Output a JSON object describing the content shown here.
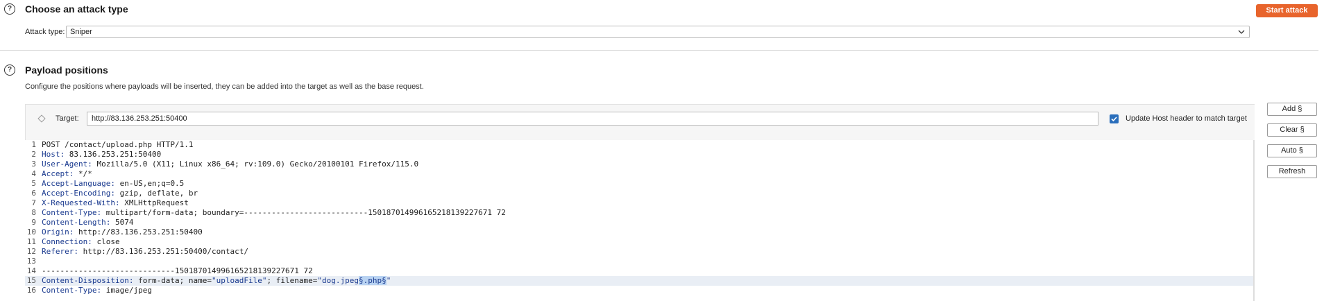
{
  "attack_section": {
    "title": "Choose an attack type",
    "start_button": "Start attack",
    "attack_type_label": "Attack type:",
    "attack_type_value": "Sniper"
  },
  "positions_section": {
    "title": "Payload positions",
    "description": "Configure the positions where payloads will be inserted, they can be added into the target as well as the base request.",
    "target_label": "Target:",
    "target_value": "http://83.136.253.251:50400",
    "update_host_label": "Update Host header to match target",
    "update_host_checked": true,
    "buttons": {
      "add": "Add §",
      "clear": "Clear §",
      "auto": "Auto §",
      "refresh": "Refresh"
    }
  },
  "request_lines": [
    {
      "n": "1",
      "name": "",
      "value": "POST /contact/upload.php HTTP/1.1"
    },
    {
      "n": "2",
      "name": "Host:",
      "value": " 83.136.253.251:50400"
    },
    {
      "n": "3",
      "name": "User-Agent:",
      "value": " Mozilla/5.0 (X11; Linux x86_64; rv:109.0) Gecko/20100101 Firefox/115.0"
    },
    {
      "n": "4",
      "name": "Accept:",
      "value": " */*"
    },
    {
      "n": "5",
      "name": "Accept-Language:",
      "value": " en-US,en;q=0.5"
    },
    {
      "n": "6",
      "name": "Accept-Encoding:",
      "value": " gzip, deflate, br"
    },
    {
      "n": "7",
      "name": "X-Requested-With:",
      "value": " XMLHttpRequest"
    },
    {
      "n": "8",
      "name": "Content-Type:",
      "value": " multipart/form-data; boundary=---------------------------150187014996165218139227671 72"
    },
    {
      "n": "9",
      "name": "Content-Length:",
      "value": " 5074"
    },
    {
      "n": "10",
      "name": "Origin:",
      "value": " http://83.136.253.251:50400"
    },
    {
      "n": "11",
      "name": "Connection:",
      "value": " close"
    },
    {
      "n": "12",
      "name": "Referer:",
      "value": " http://83.136.253.251:50400/contact/"
    },
    {
      "n": "13",
      "name": "",
      "value": ""
    },
    {
      "n": "14",
      "name": "",
      "value": "-----------------------------150187014996165218139227671 72"
    },
    {
      "n": "15",
      "name": "Content-Disposition:",
      "value": " form-data; name=",
      "s1": "\"uploadFile\"",
      "mid": "; filename=",
      "s2a": "\"dog.jpeg",
      "sel": "§.php§",
      "s2b": "\""
    },
    {
      "n": "16",
      "name": "Content-Type:",
      "value": " image/jpeg"
    }
  ]
}
